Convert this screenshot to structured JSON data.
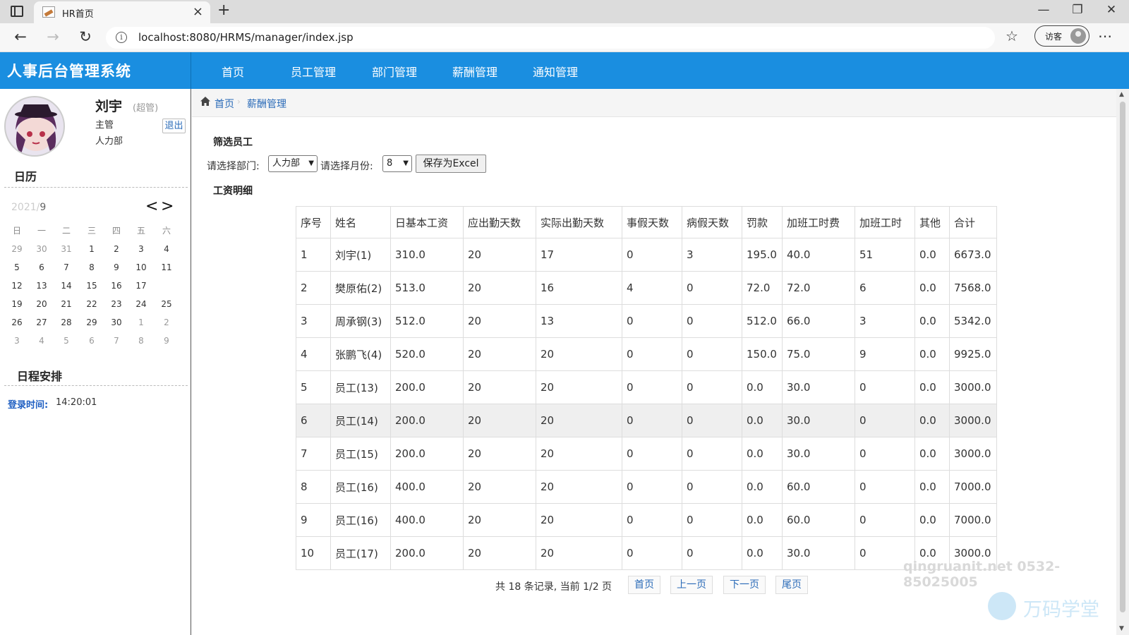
{
  "browser": {
    "tab_title": "HR首页",
    "url": "localhost:8080/HRMS/manager/index.jsp",
    "profile_label": "访客"
  },
  "app": {
    "title": "人事后台管理系统",
    "nav": [
      "首页",
      "员工管理",
      "部门管理",
      "薪酬管理",
      "通知管理"
    ]
  },
  "user": {
    "name": "刘宇",
    "tag": "(超管)",
    "role": "主管",
    "dept": "人力部",
    "logout": "退出"
  },
  "calendar": {
    "title": "日历",
    "year": "2021/",
    "month": "9",
    "prev": "<",
    "next": ">",
    "weekdays": [
      "日",
      "一",
      "二",
      "三",
      "四",
      "五",
      "六"
    ],
    "weeks": [
      [
        "29",
        "30",
        "31",
        "1",
        "2",
        "3",
        "4"
      ],
      [
        "5",
        "6",
        "7",
        "8",
        "9",
        "10",
        "11"
      ],
      [
        "12",
        "13",
        "14",
        "15",
        "16",
        "17",
        "18"
      ],
      [
        "19",
        "20",
        "21",
        "22",
        "23",
        "24",
        "25"
      ],
      [
        "26",
        "27",
        "28",
        "29",
        "30",
        "1",
        "2"
      ],
      [
        "3",
        "4",
        "5",
        "6",
        "7",
        "8",
        "9"
      ]
    ],
    "today": "18"
  },
  "schedule": {
    "title": "日程安排",
    "login_label": "登录时间:",
    "login_time": "14:20:01"
  },
  "breadcrumb": [
    "首页",
    "薪酬管理"
  ],
  "filter": {
    "title": "筛选员工",
    "dept_label": "请选择部门:",
    "dept_value": "人力部",
    "month_label": "请选择月份:",
    "month_value": "8",
    "export_button": "保存为Excel"
  },
  "salary": {
    "title": "工资明细",
    "columns": [
      "序号",
      "姓名",
      "日基本工资",
      "应出勤天数",
      "实际出勤天数",
      "事假天数",
      "病假天数",
      "罚款",
      "加班工时费",
      "加班工时",
      "其他",
      "合计"
    ],
    "rows": [
      [
        "1",
        "刘宇(1)",
        "310.0",
        "20",
        "17",
        "0",
        "3",
        "195.0",
        "40.0",
        "51",
        "0.0",
        "6673.0"
      ],
      [
        "2",
        "樊原佑(2)",
        "513.0",
        "20",
        "16",
        "4",
        "0",
        "72.0",
        "72.0",
        "6",
        "0.0",
        "7568.0"
      ],
      [
        "3",
        "周承钢(3)",
        "512.0",
        "20",
        "13",
        "0",
        "0",
        "512.0",
        "66.0",
        "3",
        "0.0",
        "5342.0"
      ],
      [
        "4",
        "张鹏飞(4)",
        "520.0",
        "20",
        "20",
        "0",
        "0",
        "150.0",
        "75.0",
        "9",
        "0.0",
        "9925.0"
      ],
      [
        "5",
        "员工(13)",
        "200.0",
        "20",
        "20",
        "0",
        "0",
        "0.0",
        "30.0",
        "0",
        "0.0",
        "3000.0"
      ],
      [
        "6",
        "员工(14)",
        "200.0",
        "20",
        "20",
        "0",
        "0",
        "0.0",
        "30.0",
        "0",
        "0.0",
        "3000.0"
      ],
      [
        "7",
        "员工(15)",
        "200.0",
        "20",
        "20",
        "0",
        "0",
        "0.0",
        "30.0",
        "0",
        "0.0",
        "3000.0"
      ],
      [
        "8",
        "员工(16)",
        "400.0",
        "20",
        "20",
        "0",
        "0",
        "0.0",
        "60.0",
        "0",
        "0.0",
        "7000.0"
      ],
      [
        "9",
        "员工(16)",
        "400.0",
        "20",
        "20",
        "0",
        "0",
        "0.0",
        "60.0",
        "0",
        "0.0",
        "7000.0"
      ],
      [
        "10",
        "员工(17)",
        "200.0",
        "20",
        "20",
        "0",
        "0",
        "0.0",
        "30.0",
        "0",
        "0.0",
        "3000.0"
      ]
    ],
    "highlight_row": 6
  },
  "pager": {
    "info": "共 18 条记录,  当前 1/2 页",
    "first": "首页",
    "prev": "上一页",
    "next": "下一页",
    "last": "尾页"
  },
  "watermark": {
    "text": "qingruanit.net 0532-85025005",
    "brand": "万码学堂"
  },
  "colors": {
    "header_blue": "#1a8ee0",
    "link_blue": "#2a6bb8",
    "today_pink": "#ef6b7b"
  }
}
